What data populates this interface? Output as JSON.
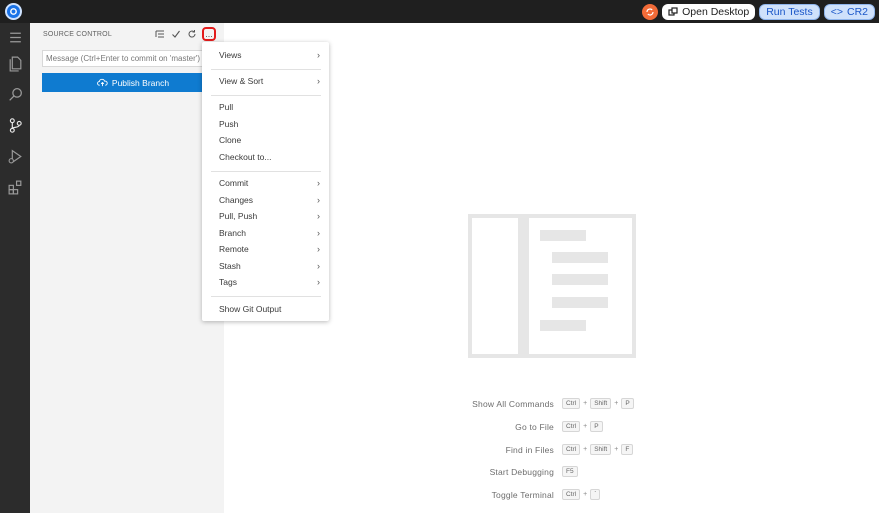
{
  "topbar": {
    "open_desktop_label": "Open Desktop",
    "run_tests_label": "Run Tests",
    "cr2_label": "CR2",
    "cr2_prefix": "<>"
  },
  "source_control": {
    "title": "SOURCE CONTROL",
    "commit_placeholder": "Message (Ctrl+Enter to commit on 'master')",
    "publish_label": "Publish Branch",
    "more_label": "..."
  },
  "menu": {
    "items": [
      {
        "label": "Views",
        "submenu": true
      },
      {
        "label": "View & Sort",
        "submenu": true
      },
      {
        "label": "Pull",
        "submenu": false
      },
      {
        "label": "Push",
        "submenu": false
      },
      {
        "label": "Clone",
        "submenu": false
      },
      {
        "label": "Checkout to...",
        "submenu": false
      },
      {
        "label": "Commit",
        "submenu": true
      },
      {
        "label": "Changes",
        "submenu": true
      },
      {
        "label": "Pull, Push",
        "submenu": true
      },
      {
        "label": "Branch",
        "submenu": true
      },
      {
        "label": "Remote",
        "submenu": true
      },
      {
        "label": "Stash",
        "submenu": true
      },
      {
        "label": "Tags",
        "submenu": true
      },
      {
        "label": "Show Git Output",
        "submenu": false
      }
    ],
    "chevron": "›"
  },
  "shortcuts": [
    {
      "label": "Show All Commands",
      "keys": [
        "Ctrl",
        "Shift",
        "P"
      ]
    },
    {
      "label": "Go to File",
      "keys": [
        "Ctrl",
        "P"
      ]
    },
    {
      "label": "Find in Files",
      "keys": [
        "Ctrl",
        "Shift",
        "F"
      ]
    },
    {
      "label": "Start Debugging",
      "keys": [
        "F5"
      ]
    },
    {
      "label": "Toggle Terminal",
      "keys": [
        "Ctrl",
        "`"
      ]
    }
  ],
  "colors": {
    "accent": "#0f7bd0",
    "highlight": "#e31b1b",
    "activitybar": "#2c2c2c",
    "topbar": "#1f1f1f"
  }
}
